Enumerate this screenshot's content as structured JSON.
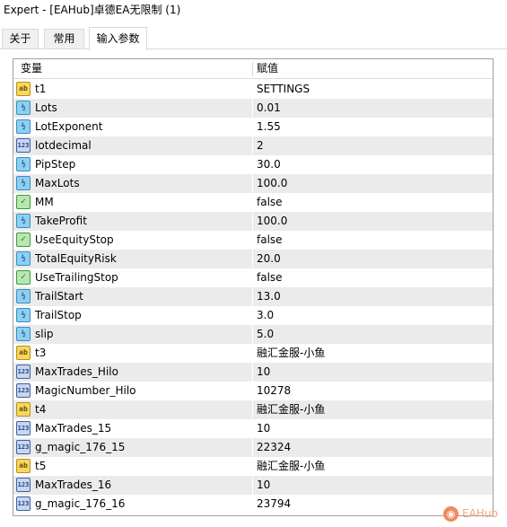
{
  "window": {
    "title": "Expert - [EAHub]卓德EA无限制 (1)"
  },
  "tabs": [
    {
      "label": "关于",
      "active": false
    },
    {
      "label": "常用",
      "active": false
    },
    {
      "label": "输入参数",
      "active": true
    }
  ],
  "table": {
    "headers": {
      "variable": "变量",
      "value": "赋值"
    },
    "rows": [
      {
        "icon": "string-icon",
        "name": "t1",
        "value": "SETTINGS"
      },
      {
        "icon": "double-icon",
        "name": "Lots",
        "value": "0.01"
      },
      {
        "icon": "double-icon",
        "name": "LotExponent",
        "value": "1.55"
      },
      {
        "icon": "integer-icon",
        "name": "lotdecimal",
        "value": "2"
      },
      {
        "icon": "double-icon",
        "name": "PipStep",
        "value": "30.0"
      },
      {
        "icon": "double-icon",
        "name": "MaxLots",
        "value": "100.0"
      },
      {
        "icon": "bool-icon",
        "name": "MM",
        "value": "false"
      },
      {
        "icon": "double-icon",
        "name": "TakeProfit",
        "value": "100.0"
      },
      {
        "icon": "bool-icon",
        "name": "UseEquityStop",
        "value": "false"
      },
      {
        "icon": "double-icon",
        "name": "TotalEquityRisk",
        "value": "20.0"
      },
      {
        "icon": "bool-icon",
        "name": "UseTrailingStop",
        "value": "false"
      },
      {
        "icon": "double-icon",
        "name": "TrailStart",
        "value": "13.0"
      },
      {
        "icon": "double-icon",
        "name": "TrailStop",
        "value": "3.0"
      },
      {
        "icon": "double-icon",
        "name": "slip",
        "value": "5.0"
      },
      {
        "icon": "string-icon",
        "name": "t3",
        "value": "融汇金服-小鱼"
      },
      {
        "icon": "integer-icon",
        "name": "MaxTrades_Hilo",
        "value": "10"
      },
      {
        "icon": "integer-icon",
        "name": "MagicNumber_Hilo",
        "value": "10278"
      },
      {
        "icon": "string-icon",
        "name": "t4",
        "value": "融汇金服-小鱼"
      },
      {
        "icon": "integer-icon",
        "name": "MaxTrades_15",
        "value": "10"
      },
      {
        "icon": "integer-icon",
        "name": "g_magic_176_15",
        "value": "22324"
      },
      {
        "icon": "string-icon",
        "name": "t5",
        "value": "融汇金服-小鱼"
      },
      {
        "icon": "integer-icon",
        "name": "MaxTrades_16",
        "value": "10"
      },
      {
        "icon": "integer-icon",
        "name": "g_magic_176_16",
        "value": "23794"
      }
    ]
  },
  "icon_glyphs": {
    "string-icon": "ab",
    "double-icon": "½",
    "integer-icon": "123",
    "bool-icon": "✓"
  },
  "watermark": {
    "text": "EAHub",
    "logo_icon": "eahub-logo-icon"
  },
  "colors": {
    "row_alt": "#ebebeb",
    "border": "#a0a0a0",
    "watermark": "#f08a5d"
  }
}
